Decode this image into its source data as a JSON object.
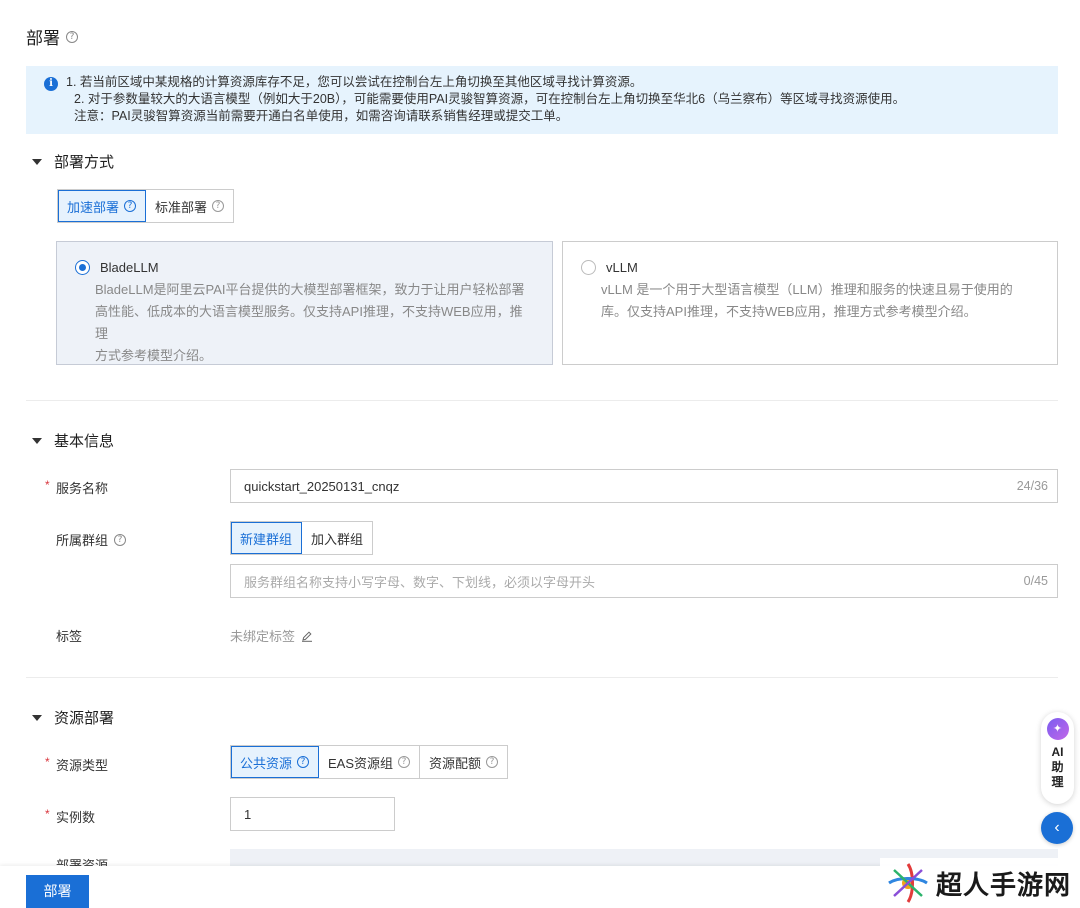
{
  "page": {
    "title": "部署",
    "help_icon": "question-circle-icon"
  },
  "notice": {
    "icon": "info-icon",
    "lines": [
      "1. 若当前区域中某规格的计算资源库存不足，您可以尝试在控制台左上角切换至其他区域寻找计算资源。",
      "2. 对于参数量较大的大语言模型（例如大于20B），可能需要使用PAI灵骏智算资源，可在控制台左上角切换至华北6（乌兰察布）等区域寻找资源使用。",
      "注意：PAI灵骏智算资源当前需要开通白名单使用，如需咨询请联系销售经理或提交工单。"
    ]
  },
  "deploy_method": {
    "title": "部署方式",
    "tabs": [
      {
        "label": "加速部署",
        "active": true
      },
      {
        "label": "标准部署",
        "active": false
      }
    ],
    "cards": [
      {
        "title": "BladeLLM",
        "selected": true,
        "desc_lines": [
          "BladeLLM是阿里云PAI平台提供的大模型部署框架，致力于让用户轻松部署",
          "高性能、低成本的大语言模型服务。仅支持API推理，不支持WEB应用，推理",
          "方式参考模型介绍。"
        ]
      },
      {
        "title": "vLLM",
        "selected": false,
        "desc_lines": [
          "vLLM 是一个用于大型语言模型（LLM）推理和服务的快速且易于使用的",
          "库。仅支持API推理，不支持WEB应用，推理方式参考模型介绍。"
        ]
      }
    ]
  },
  "basic_info": {
    "title": "基本信息",
    "service_name": {
      "label": "服务名称",
      "value": "quickstart_20250131_cnqz",
      "count": "24/36"
    },
    "group": {
      "label": "所属群组",
      "tabs": [
        {
          "label": "新建群组",
          "active": true
        },
        {
          "label": "加入群组",
          "active": false
        }
      ],
      "placeholder": "服务群组名称支持小写字母、数字、下划线，必须以字母开头",
      "count": "0/45"
    },
    "tags": {
      "label": "标签",
      "value": "未绑定标签",
      "edit_icon": "pencil-icon"
    }
  },
  "resource": {
    "title": "资源部署",
    "type": {
      "label": "资源类型",
      "tabs": [
        {
          "label": "公共资源",
          "active": true
        },
        {
          "label": "EAS资源组",
          "active": false
        },
        {
          "label": "资源配额",
          "active": false
        }
      ]
    },
    "instances": {
      "label": "实例数",
      "value": "1"
    },
    "deploy_resource": {
      "label": "部署资源"
    }
  },
  "ai_assistant": {
    "label": "AI助理",
    "collapse_icon": "chevron-left-icon"
  },
  "footer": {
    "deploy_label": "部署"
  },
  "watermark": {
    "text": "超人手游网"
  },
  "colors": {
    "primary": "#1a6fd6",
    "notice_bg": "#e6f3fd",
    "required": "#d9363e"
  }
}
